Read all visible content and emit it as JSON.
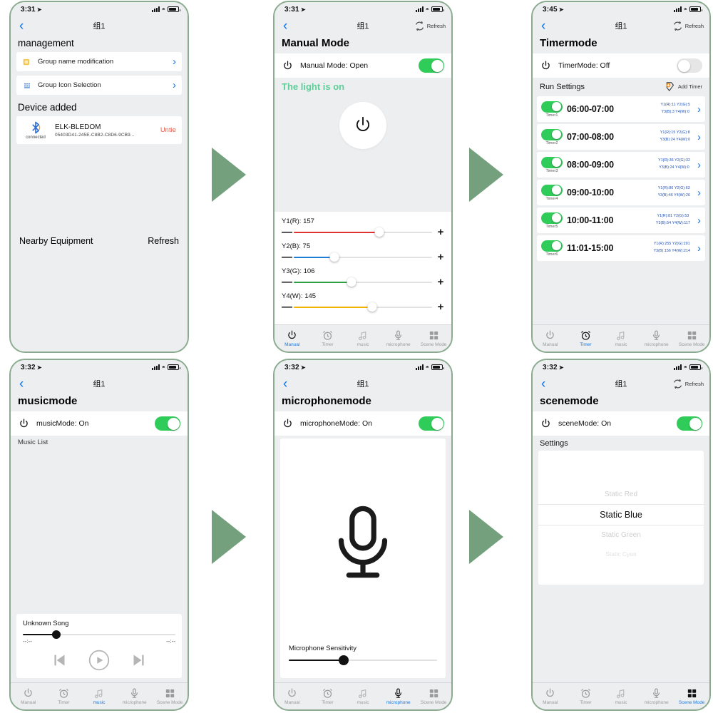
{
  "status_bar": {
    "time_331": "3:31",
    "time_332": "3:32",
    "time_345": "3:45",
    "location_icon": "location-arrow-icon",
    "signal_icon": "cellular-signal-icon",
    "wifi_icon": "wifi-icon",
    "battery_icon": "battery-icon"
  },
  "common": {
    "group_title": "组1",
    "back_icon": "back-chevron-icon",
    "refresh_label": "Refresh",
    "refresh_icon": "refresh-icon",
    "power_icon": "power-icon",
    "chevron_right_icon": "chevron-right-icon"
  },
  "tabs": [
    {
      "label": "Manual",
      "icon": "power-icon"
    },
    {
      "label": "Timer",
      "icon": "alarm-clock-icon"
    },
    {
      "label": "music",
      "icon": "music-note-icon"
    },
    {
      "label": "microphone",
      "icon": "microphone-icon"
    },
    {
      "label": "Scene Mode",
      "icon": "grid-squares-icon"
    }
  ],
  "panel1": {
    "time": "3:31",
    "title": "组1",
    "section_management": "management",
    "rows": [
      {
        "label": "Group name modification",
        "icon": "folder-icon"
      },
      {
        "label": "Group Icon Selection",
        "icon": "grid-dots-icon"
      }
    ],
    "section_device": "Device added",
    "device": {
      "icon": "bluetooth-icon",
      "connected": "connected",
      "name": "ELK-BLEDOM",
      "mac": "05403D41-245E-C8B2-C8D6-9CB9...",
      "untie": "Untie"
    },
    "nearby_label": "Nearby Equipment",
    "refresh_label": "Refresh"
  },
  "panel2": {
    "time": "3:31",
    "title": "组1",
    "refresh": "Refresh",
    "page_title": "Manual Mode",
    "mode_label": "Manual Mode: Open",
    "toggle_on": true,
    "light_status": "The light is on",
    "big_power_icon": "power-icon",
    "sliders": [
      {
        "label": "Y1(R): 157",
        "name": "Y1(R)",
        "value": 157,
        "max": 255,
        "color": "#e03131"
      },
      {
        "label": "Y2(B): 75",
        "name": "Y2(B)",
        "value": 75,
        "max": 255,
        "color": "#1c7ed6"
      },
      {
        "label": "Y3(G): 106",
        "name": "Y3(G)",
        "value": 106,
        "max": 255,
        "color": "#2f9e44"
      },
      {
        "label": "Y4(W): 145",
        "name": "Y4(W)",
        "value": 145,
        "max": 255,
        "color": "#f0b400"
      }
    ],
    "minus": "—",
    "plus": "+",
    "active_tab": "Manual"
  },
  "panel3": {
    "time": "3:45",
    "title": "组1",
    "refresh": "Refresh",
    "page_title": "Timermode",
    "mode_label": "TimerMode: Off",
    "toggle_on": false,
    "run_settings": "Run Settings",
    "add_timer": "Add Timer",
    "add_timer_icon": "add-timer-icon",
    "timers": [
      {
        "name": "Timer1",
        "time": "06:00-07:00",
        "line1": "Y1(R):11  Y2(G):5",
        "line2": "Y3(B):3  Y4(W):0",
        "on": true
      },
      {
        "name": "Timer2",
        "time": "07:00-08:00",
        "line1": "Y1(R):15  Y2(G):8",
        "line2": "Y3(B):24  Y4(W):0",
        "on": true
      },
      {
        "name": "Timer3",
        "time": "08:00-09:00",
        "line1": "Y1(R):36  Y2(G):32",
        "line2": "Y3(B):24  Y4(W):0",
        "on": true
      },
      {
        "name": "Timer4",
        "time": "09:00-10:00",
        "line1": "Y1(R):86  Y2(G):63",
        "line2": "Y3(B):46  Y4(W):26",
        "on": true
      },
      {
        "name": "Timer5",
        "time": "10:00-11:00",
        "line1": "Y1(R):81  Y2(G):53",
        "line2": "Y3(B):54  Y4(W):117",
        "on": true
      },
      {
        "name": "Timer6",
        "time": "11:01-15:00",
        "line1": "Y1(R):255  Y2(G):201",
        "line2": "Y3(B):156  Y4(W):214",
        "on": true
      }
    ],
    "active_tab": "Timer"
  },
  "panel4": {
    "time": "3:32",
    "title": "组1",
    "page_title": "musicmode",
    "mode_label": "musicMode: On",
    "toggle_on": true,
    "music_list": "Music List",
    "player": {
      "song": "Unknown Song",
      "elapsed": "--:--",
      "remaining": "--:--",
      "progress_pct": 22,
      "prev_icon": "skip-previous-icon",
      "play_icon": "play-icon",
      "next_icon": "skip-next-icon"
    },
    "active_tab": "music"
  },
  "panel5": {
    "time": "3:32",
    "title": "组1",
    "page_title": "microphonemode",
    "mode_label": "microphoneMode: On",
    "toggle_on": true,
    "mic_icon": "microphone-icon",
    "sensitivity_label": "Microphone Sensitivity",
    "sensitivity_pct": 37,
    "active_tab": "microphone"
  },
  "panel6": {
    "time": "3:32",
    "title": "组1",
    "refresh": "Refresh",
    "page_title": "scenemode",
    "mode_label": "sceneMode: On",
    "toggle_on": true,
    "settings_label": "Settings",
    "scenes": [
      {
        "label": "Static Red",
        "state": "dim"
      },
      {
        "label": "Static Blue",
        "state": "selected"
      },
      {
        "label": "Static Green",
        "state": "dim"
      },
      {
        "label": "Static Cyan",
        "state": "dimmer"
      }
    ],
    "active_tab": "Scene Mode"
  },
  "colors": {
    "frame_border": "#8aab8f",
    "arrow_green": "#74a07e",
    "toggle_on": "#30cc5a",
    "accent_blue": "#0a74ef",
    "untie_red": "#e8604c",
    "light_on_green": "#5fcf9a"
  }
}
